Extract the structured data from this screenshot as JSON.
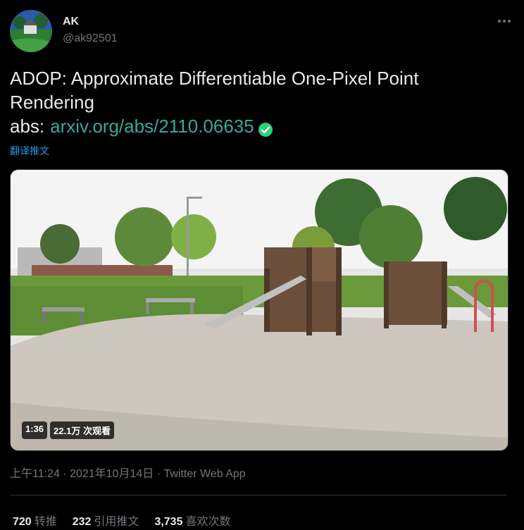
{
  "tweet": {
    "author": {
      "display_name": "AK",
      "handle": "@ak92501"
    },
    "text_line1": "ADOP: Approximate Differentiable One-Pixel Point",
    "text_line2": "Rendering",
    "abs_prefix": "abs:",
    "link_text": "arxiv.org/abs/2110.06635",
    "translate_label": "翻译推文",
    "video": {
      "duration": "1:36",
      "views": "22.1万 次观看"
    },
    "timestamp": "上午11:24 · 2021年10月14日 · ",
    "source": "Twitter Web App",
    "stats": [
      {
        "count": "720",
        "label": "转推"
      },
      {
        "count": "232",
        "label": "引用推文"
      },
      {
        "count": "3,735",
        "label": "喜欢次数"
      }
    ]
  },
  "colors": {
    "background": "#000000",
    "text": "#e7e9ea",
    "muted": "#71767b",
    "link": "#37a99b",
    "translate": "#1d9bf0",
    "verified": "#2bd07b"
  },
  "icons": {
    "more": "more-horizontal-icon",
    "verified": "check-circle-icon"
  }
}
